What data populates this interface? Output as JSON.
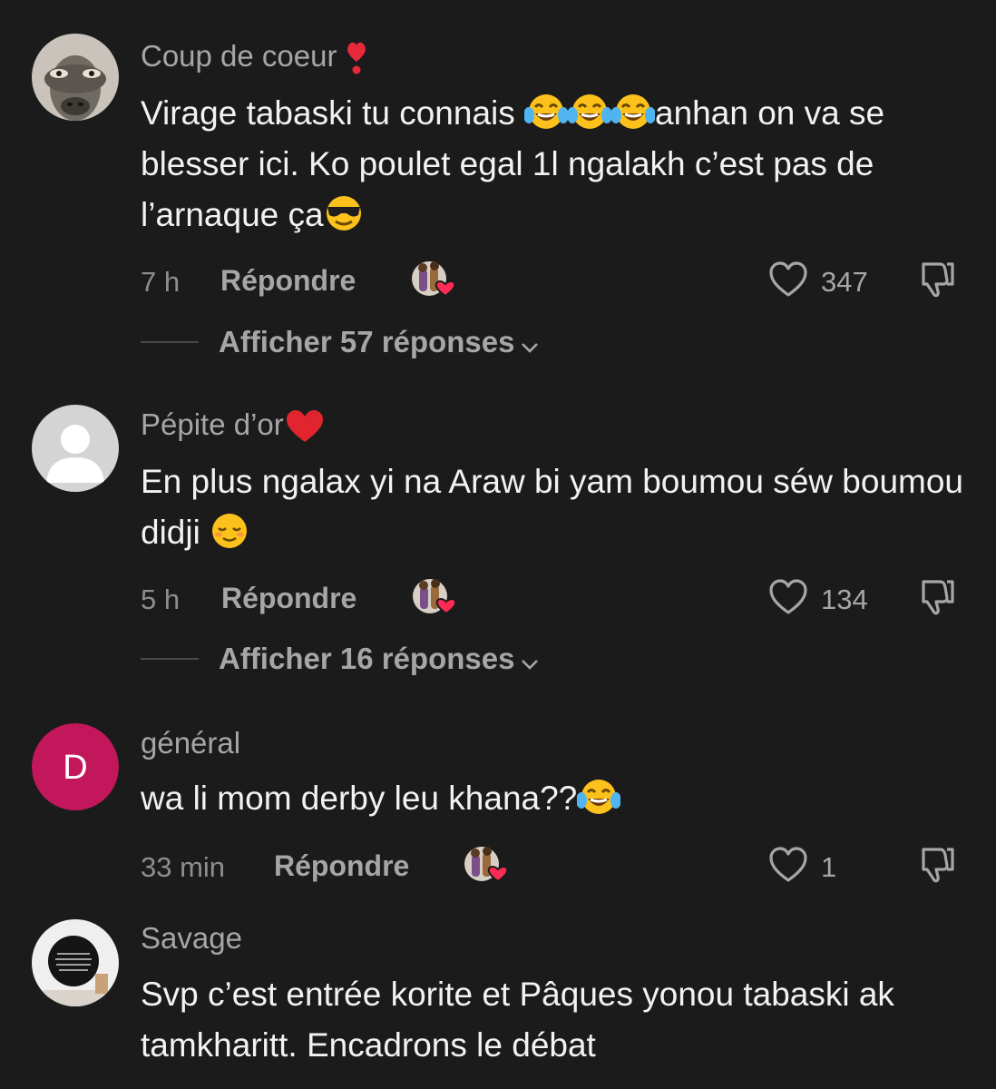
{
  "comments": [
    {
      "username": "Coup de coeur",
      "username_emoji": "heart-exclamation",
      "avatar": "camel-photo",
      "text_parts": [
        "Virage tabaski tu connais ",
        "anhan on va se blesser ici. Ko poulet egal 1l ngalakh c’est pas de l’arnaque ça"
      ],
      "time": "7 h",
      "reply_label": "Répondre",
      "likes": "347",
      "view_replies": "Afficher 57 réponses"
    },
    {
      "username": "Pépite d’or",
      "username_emoji": "red-heart",
      "avatar": "default-avatar",
      "text_parts": [
        "En plus ngalax yi na Araw bi yam boumou séw boumou didji "
      ],
      "time": "5 h",
      "reply_label": "Répondre",
      "likes": "134",
      "view_replies": "Afficher 16 réponses"
    },
    {
      "username": "général",
      "avatar_letter": "D",
      "avatar_color": "#c2185b",
      "text_parts": [
        "wa li mom derby leu khana??"
      ],
      "time": "33 min",
      "reply_label": "Répondre",
      "likes": "1"
    },
    {
      "username": "Savage",
      "avatar": "framed-quote-photo",
      "text_parts": [
        "Svp c’est entrée korite et Pâques yonou tabaski ak tamkharitt. Encadrons le débat"
      ]
    }
  ],
  "colors": {
    "background": "#1b1b1b",
    "creator_heart": "#fe2c55"
  }
}
